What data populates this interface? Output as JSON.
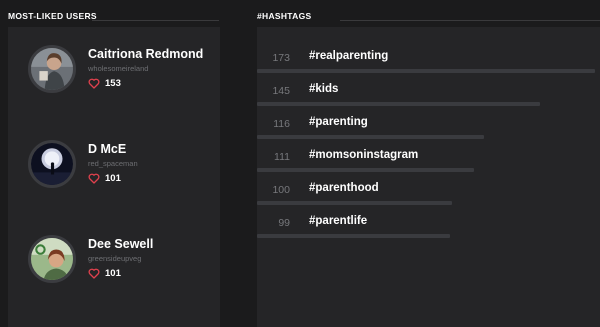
{
  "most_liked_users": {
    "title": "MOST-LIKED USERS",
    "users": [
      {
        "name": "Caitriona Redmond",
        "handle": "wholesomeireland",
        "likes": "153"
      },
      {
        "name": "D McE",
        "handle": "red_spaceman",
        "likes": "101"
      },
      {
        "name": "Dee Sewell",
        "handle": "greensideupveg",
        "likes": "101"
      }
    ]
  },
  "hashtags": {
    "title": "#HASHTAGS",
    "max_count": 173,
    "items": [
      {
        "count": 173,
        "tag": "#realparenting"
      },
      {
        "count": 145,
        "tag": "#kids"
      },
      {
        "count": 116,
        "tag": "#parenting"
      },
      {
        "count": 111,
        "tag": "#momsoninstagram"
      },
      {
        "count": 100,
        "tag": "#parenthood"
      },
      {
        "count": 99,
        "tag": "#parentlife"
      }
    ]
  },
  "colors": {
    "background": "#1b1b1c",
    "panel": "#252527",
    "heart": "#e0414d",
    "bar": "#3a3b3f",
    "muted_text": "#6d6e72"
  }
}
